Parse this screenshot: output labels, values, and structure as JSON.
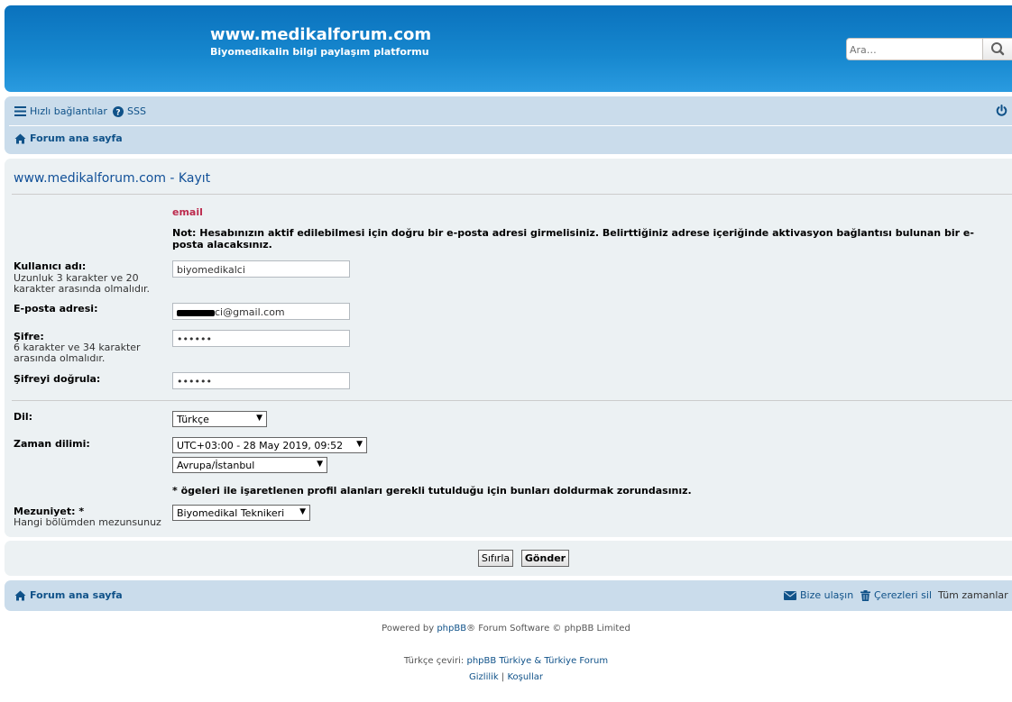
{
  "header": {
    "site_title": "www.medikalforum.com",
    "site_description": "Biyomedikalin bilgi paylaşım platformu",
    "search_placeholder": "Ara…"
  },
  "navbar": {
    "quick_links": "Hızlı bağlantılar",
    "faq": "SSS",
    "board_index": "Forum ana sayfa"
  },
  "form": {
    "page_title": "www.medikalforum.com - Kayıt",
    "error": "email",
    "note": "Not: Hesabınızın aktif edilebilmesi için doğru bir e-posta adresi girmelisiniz. Belirttiğiniz adrese içeriğinde aktivasyon bağlantısı bulunan bir e-posta alacaksınız.",
    "username_label": "Kullanıcı adı:",
    "username_hint": "Uzunluk 3 karakter ve 20 karakter arasında olmalıdır.",
    "username_value": "biyomedikalci",
    "email_label": "E-posta adresi:",
    "email_value_suffix": "ci@gmail.com",
    "password_label": "Şifre:",
    "password_hint": "6 karakter ve 34 karakter arasında olmalıdır.",
    "password_value": "••••••",
    "confirm_label": "Şifreyi doğrula:",
    "confirm_value": "••••••",
    "language_label": "Dil:",
    "language_value": "Türkçe",
    "timezone_label": "Zaman dilimi:",
    "timezone_value": "UTC+03:00 - 28 May 2019, 09:52",
    "timezone_region": "Avrupa/İstanbul",
    "required_note": "* ögeleri ile işaretlenen profil alanları gerekli tutulduğu için bunları doldurmak zorundasınız.",
    "graduation_label": "Mezuniyet: *",
    "graduation_hint": "Hangi bölümden mezunsunuz",
    "graduation_value": "Biyomedikal Teknikeri"
  },
  "buttons": {
    "reset": "Sıfırla",
    "submit": "Gönder"
  },
  "footer": {
    "board_index": "Forum ana sayfa",
    "contact": "Bize ulaşın",
    "delete_cookies": "Çerezleri sil",
    "all_times": "Tüm zamanlar",
    "powered_prefix": "Powered by ",
    "powered_link": "phpBB",
    "powered_suffix": "® Forum Software © phpBB Limited",
    "translation_prefix": "Türkçe çeviri: ",
    "translation_link": "phpBB Türkiye & Türkiye Forum",
    "privacy": "Gizlilik",
    "separator": "|",
    "terms": "Koşullar"
  },
  "colors": {
    "header_blue": "#1788cf",
    "nav_bg": "#cadceb",
    "panel_bg": "#ecf1f3",
    "link": "#105289",
    "error": "#bc2a4d"
  }
}
